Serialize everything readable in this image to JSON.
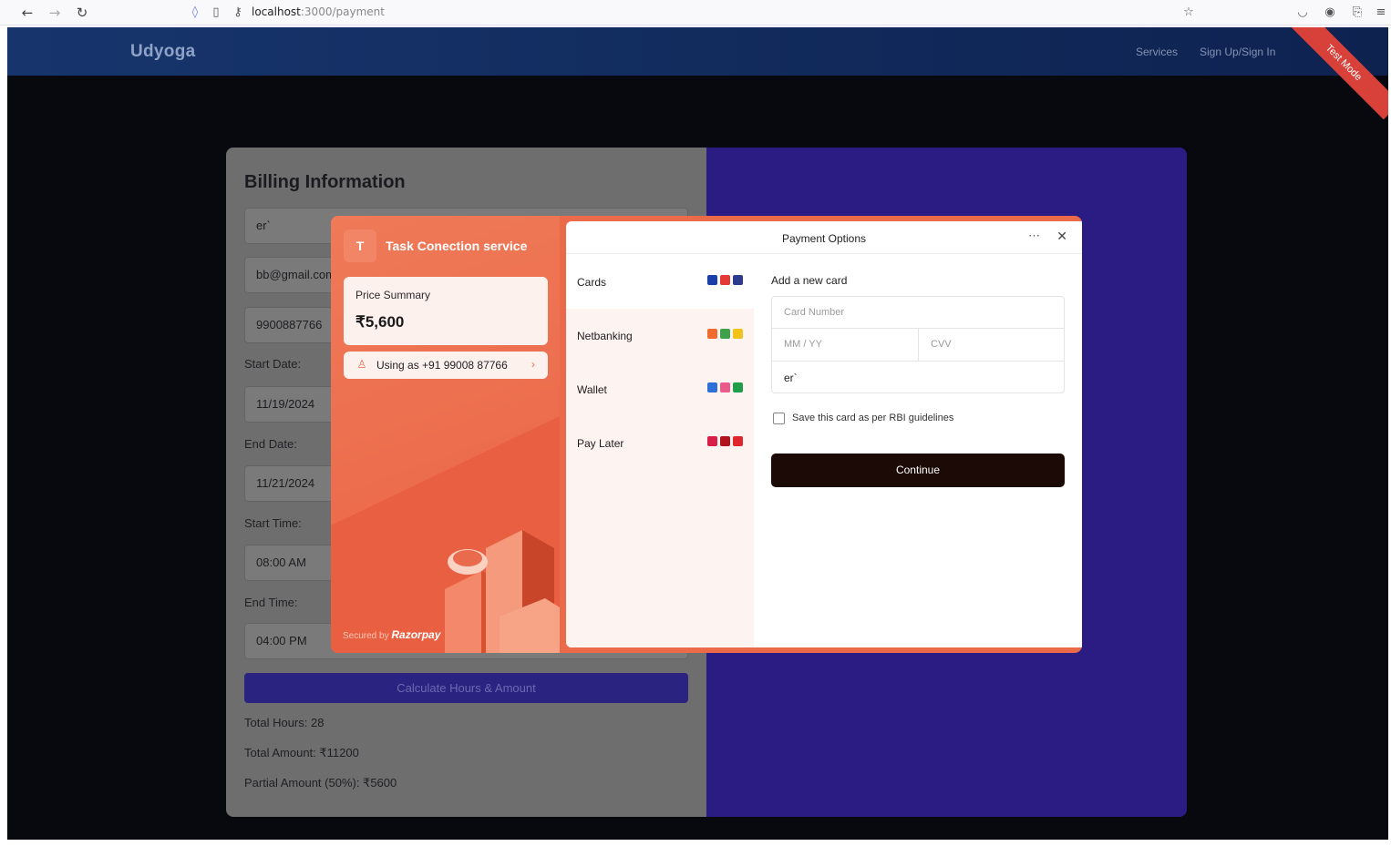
{
  "browser": {
    "url_host": "localhost",
    "url_rest": ":3000/payment",
    "back": "←",
    "forward": "→",
    "reload": "↻",
    "star": "☆"
  },
  "navbar": {
    "brand": "Udyoga",
    "links": [
      "Services",
      "Sign Up/Sign In"
    ],
    "ribbon": "Test Mode"
  },
  "billing": {
    "title": "Billing Information",
    "name_value": "er`",
    "email_value": "bb@gmail.com",
    "phone_value": "9900887766",
    "start_date_label": "Start Date:",
    "start_date_value": "11/19/2024",
    "end_date_label": "End Date:",
    "end_date_value": "11/21/2024",
    "start_time_label": "Start Time:",
    "start_time_value": "08:00 AM",
    "end_time_label": "End Time:",
    "end_time_value": "04:00 PM",
    "calculate_label": "Calculate Hours & Amount",
    "total_hours": "Total Hours: 28",
    "total_amount": "Total Amount: ₹11200",
    "partial_amount": "Partial Amount (50%): ₹5600"
  },
  "razorpay": {
    "merchant_initial": "T",
    "merchant_name": "Task Conection service",
    "price_summary_label": "Price Summary",
    "price_amount": "₹5,600",
    "user_text": "Using as +91 99008 87766",
    "secured_by": "Secured by",
    "razorpay_brand": "Razorpay",
    "title": "Payment Options",
    "methods": [
      {
        "label": "Cards",
        "icons": [
          "#1a3fa8",
          "#e53935",
          "#2e3b8c"
        ]
      },
      {
        "label": "Netbanking",
        "icons": [
          "#f06b2e",
          "#3fa14a",
          "#f2c21b"
        ]
      },
      {
        "label": "Wallet",
        "icons": [
          "#2e6fd8",
          "#e85a8a",
          "#1f9d4a"
        ]
      },
      {
        "label": "Pay Later",
        "icons": [
          "#d81f4a",
          "#b0141c",
          "#e0262d"
        ]
      }
    ],
    "form_heading": "Add a new card",
    "card_number_placeholder": "Card Number",
    "expiry_placeholder": "MM / YY",
    "cvv_placeholder": "CVV",
    "card_name_value": "er`",
    "save_card_label": "Save this card as per RBI guidelines",
    "continue_label": "Continue"
  }
}
